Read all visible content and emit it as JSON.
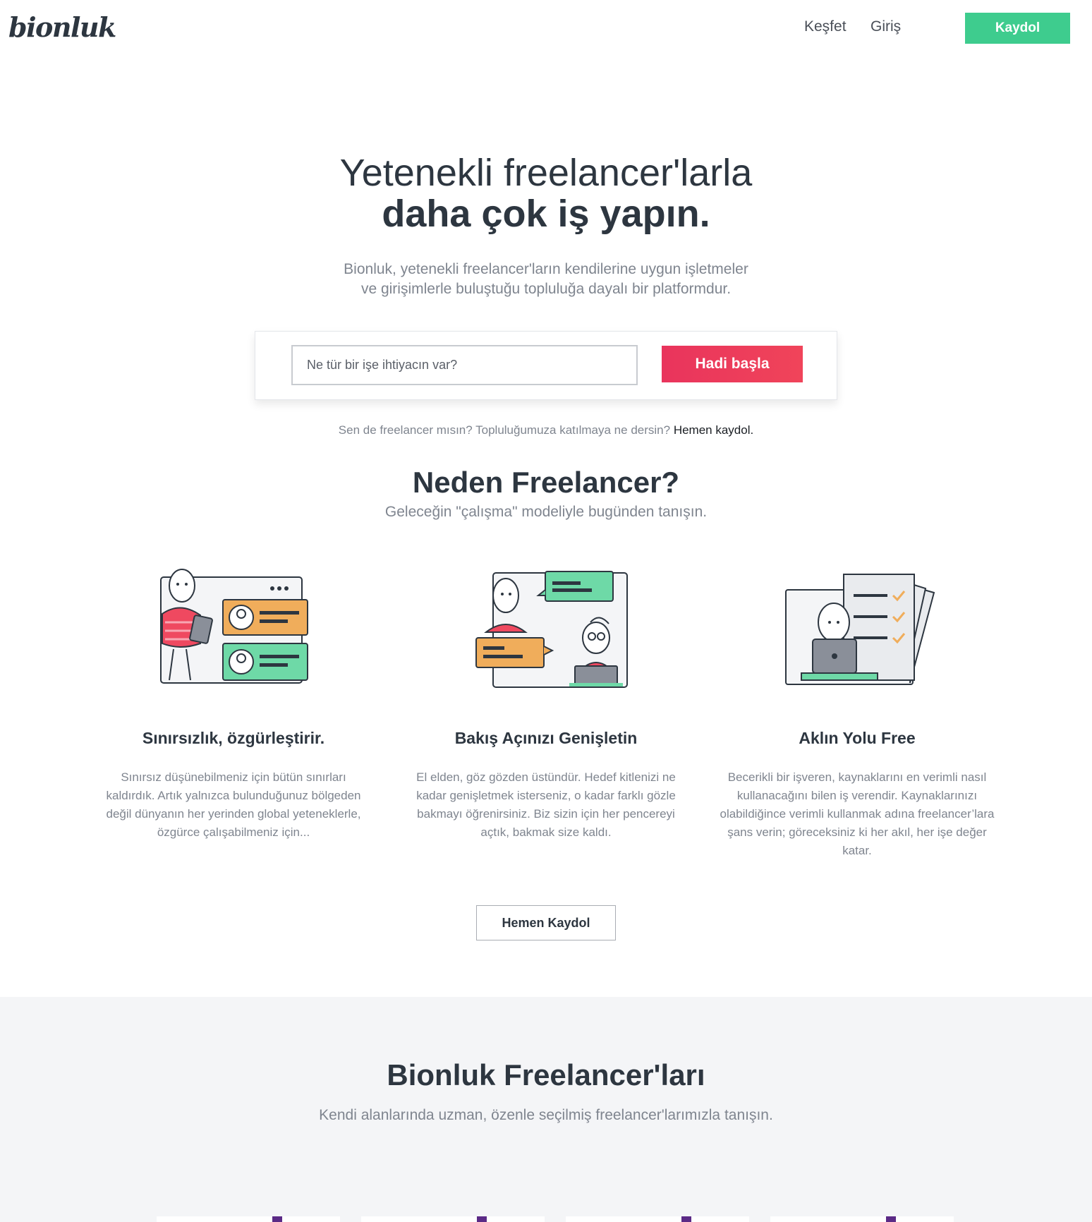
{
  "header": {
    "logo": "bionluk",
    "nav": [
      {
        "label": "Keşfet"
      },
      {
        "label": "Giriş"
      }
    ],
    "signup_label": "Kaydol"
  },
  "hero": {
    "title_line1": "Yetenekli freelancer'larla",
    "title_line2": "daha çok iş yapın.",
    "subtitle_line1": "Bionluk, yetenekli freelancer'ların kendilerine uygun işletmeler",
    "subtitle_line2": "ve girişimlerle buluştuğu topluluğa dayalı bir platformdur.",
    "search_placeholder": "Ne tür bir işe ihtiyacın var?",
    "start_label": "Hadi başla",
    "freelancer_note": "Sen de freelancer mısın? Topluluğumuza katılmaya ne dersin?",
    "freelancer_link": "Hemen kaydol."
  },
  "why": {
    "title_regular": "Neden",
    "title_bold": "Freelancer?",
    "subtitle": "Geleceğin \"çalışma\" modeliyle bugünden tanışın.",
    "features": [
      {
        "title": "Sınırsızlık, özgürleştirir.",
        "body": "Sınırsız düşünebilmeniz için bütün sınırları kaldırdık. Artık yalnızca bulunduğunuz bölgeden değil dünyanın her yerinden global yeteneklerle, özgürce çalışabilmeniz için..."
      },
      {
        "title": "Bakış Açınızı Genişletin",
        "body": "El elden, göz gözden üstündür. Hedef kitlenizi ne kadar genişletmek isterseniz, o kadar farklı gözle bakmayı öğrenirsiniz. Biz sizin için her pencereyi açtık, bakmak size kaldı."
      },
      {
        "title": "Aklın Yolu Free",
        "body": "Becerikli bir işveren, kaynaklarını en verimli nasıl kullanacağını bilen iş verendir. Kaynaklarınızı olabildiğince verimli kullanmak adına freelancer’lara şans verin; göreceksiniz ki her akıl, her işe değer katar."
      }
    ],
    "cta_label": "Hemen Kaydol"
  },
  "freelancers": {
    "title_regular": "Bionluk",
    "title_bold": "Freelancer'ları",
    "subtitle": "Kendi alanlarında uzman, özenle seçilmiş freelancer'larımızla tanışın."
  },
  "colors": {
    "brand_green": "#3ecc8e",
    "cta_red": "#ee3e5c",
    "illustration_orange": "#f0ad5b",
    "illustration_green": "#6ed9a7",
    "illustration_red": "#ef4960"
  }
}
